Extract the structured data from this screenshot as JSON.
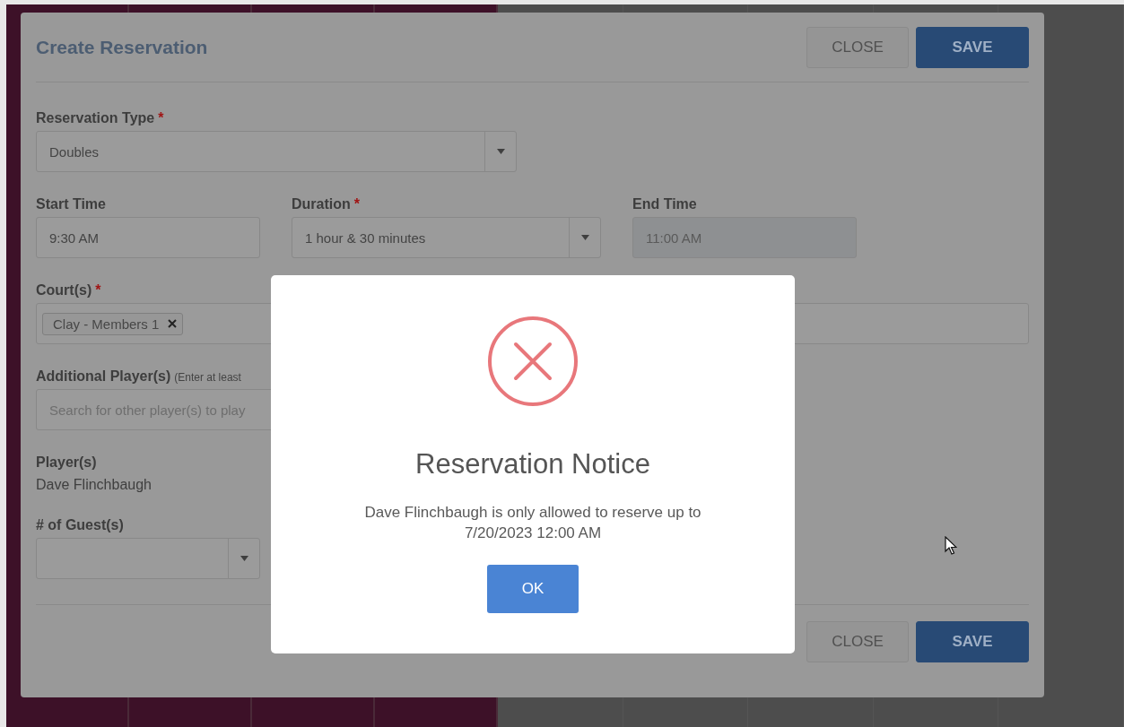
{
  "modal": {
    "title": "Create Reservation",
    "header_buttons": [
      {
        "label": "CLOSE",
        "kind": "secondary"
      },
      {
        "label": "SAVE",
        "kind": "primary"
      }
    ],
    "rows": [
      {
        "fields": [
          {
            "label": "Reservation Type",
            "required_mark": "*",
            "kind": "select",
            "value": "Doubles"
          }
        ]
      },
      {
        "fields": [
          {
            "label": "Start Time",
            "kind": "text",
            "value": "9:30 AM"
          },
          {
            "label": "Duration",
            "required_mark": "*",
            "kind": "select",
            "value": "1 hour & 30 minutes"
          },
          {
            "label": "End Time",
            "kind": "text",
            "value": "11:00 AM",
            "disabled": true
          }
        ]
      },
      {
        "fields": [
          {
            "label": "Court(s)",
            "required_mark": "*",
            "kind": "tags",
            "tags": [
              "Clay - Members 1"
            ]
          }
        ]
      },
      {
        "fields": [
          {
            "label": "Additional Player(s)",
            "hint": "(Enter at least",
            "kind": "search",
            "placeholder": "Search for other player(s) to play"
          }
        ]
      },
      {
        "fields": [
          {
            "label": "Player(s)",
            "kind": "static",
            "value": "Dave Flinchbaugh"
          }
        ]
      },
      {
        "fields": [
          {
            "label": "# of Guest(s)",
            "kind": "select"
          }
        ]
      }
    ],
    "footer_buttons": [
      {
        "label": "CLOSE",
        "kind": "secondary"
      },
      {
        "label": "SAVE",
        "kind": "primary"
      }
    ]
  },
  "notice": {
    "title": "Reservation Notice",
    "message": "Dave Flinchbaugh is only allowed to reserve up to 7/20/2023 12:00 AM",
    "button": "OK"
  }
}
